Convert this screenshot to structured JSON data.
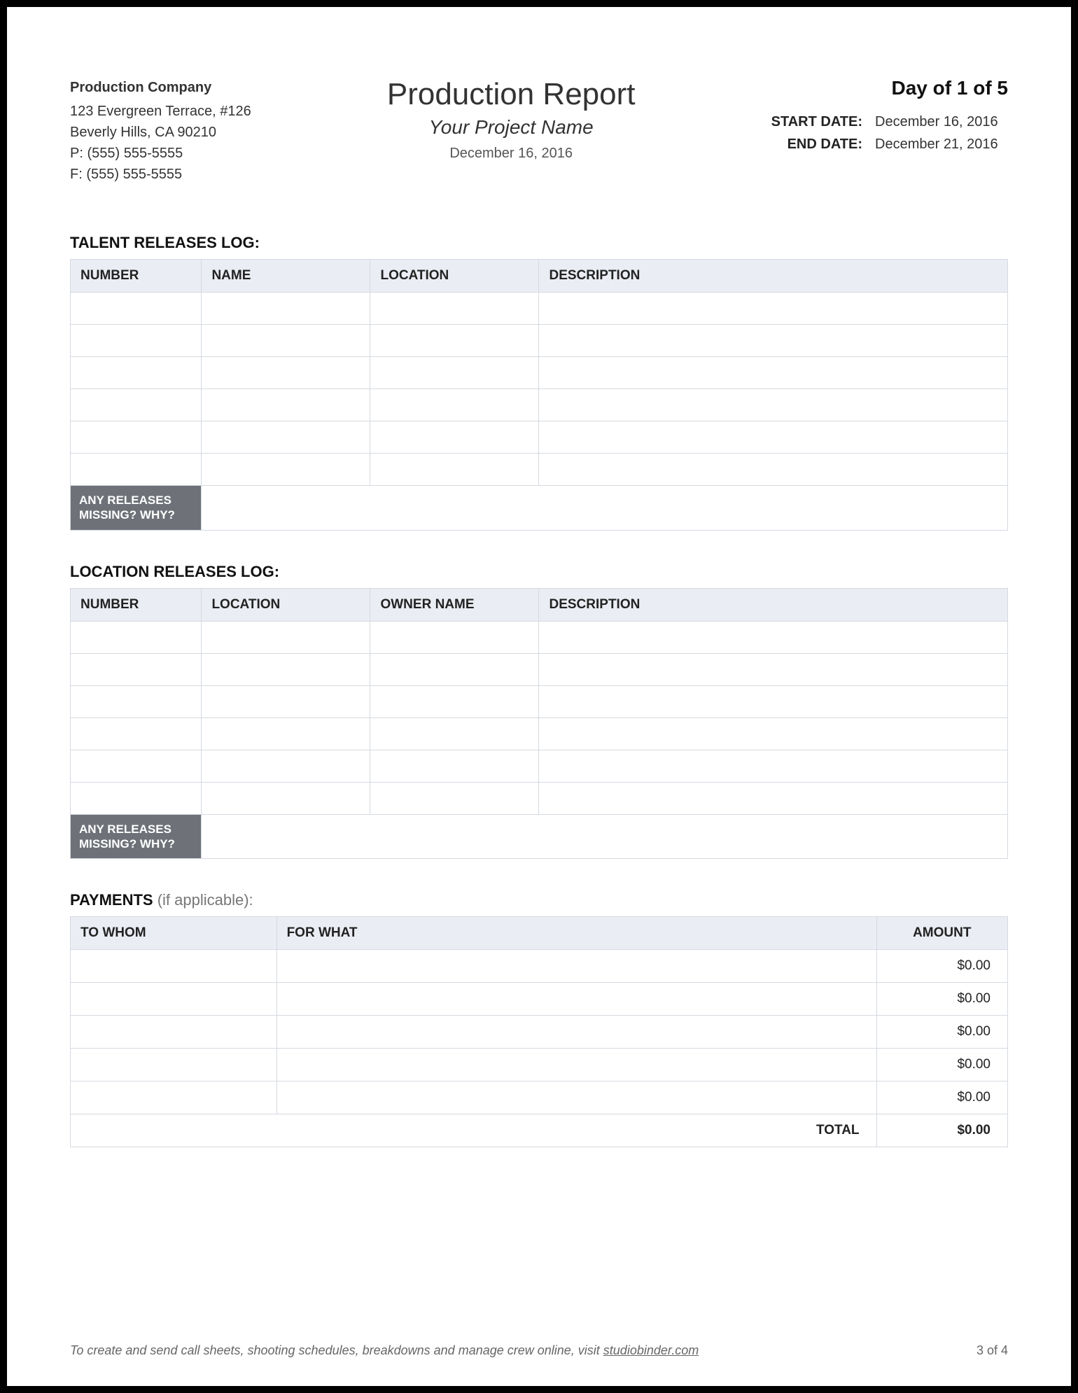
{
  "company": {
    "name": "Production Company",
    "address1": "123 Evergreen Terrace, #126",
    "address2": "Beverly Hills, CA 90210",
    "phone": "P: (555) 555-5555",
    "fax": "F: (555) 555-5555"
  },
  "title": {
    "main": "Production Report",
    "project": "Your Project Name",
    "date": "December 16, 2016"
  },
  "meta": {
    "day_of": "Day of 1 of 5",
    "start_label": "START DATE:",
    "start_value": "December 16, 2016",
    "end_label": "END DATE:",
    "end_value": "December 21, 2016"
  },
  "talent_releases": {
    "heading": "TALENT RELEASES LOG:",
    "columns": [
      "NUMBER",
      "NAME",
      "LOCATION",
      "DESCRIPTION"
    ],
    "rows": [
      [
        "",
        "",
        "",
        ""
      ],
      [
        "",
        "",
        "",
        ""
      ],
      [
        "",
        "",
        "",
        ""
      ],
      [
        "",
        "",
        "",
        ""
      ],
      [
        "",
        "",
        "",
        ""
      ],
      [
        "",
        "",
        "",
        ""
      ]
    ],
    "footer_label": "ANY RELEASES MISSING? WHY?",
    "footer_value": ""
  },
  "location_releases": {
    "heading": "LOCATION RELEASES LOG:",
    "columns": [
      "NUMBER",
      "LOCATION",
      "OWNER NAME",
      "DESCRIPTION"
    ],
    "rows": [
      [
        "",
        "",
        "",
        ""
      ],
      [
        "",
        "",
        "",
        ""
      ],
      [
        "",
        "",
        "",
        ""
      ],
      [
        "",
        "",
        "",
        ""
      ],
      [
        "",
        "",
        "",
        ""
      ],
      [
        "",
        "",
        "",
        ""
      ]
    ],
    "footer_label": "ANY RELEASES MISSING? WHY?",
    "footer_value": ""
  },
  "payments": {
    "heading_bold": "PAYMENTS",
    "heading_muted": "  (if applicable):",
    "columns": [
      "TO WHOM",
      "FOR WHAT",
      "AMOUNT"
    ],
    "rows": [
      {
        "to": "",
        "for": "",
        "amount": "$0.00"
      },
      {
        "to": "",
        "for": "",
        "amount": "$0.00"
      },
      {
        "to": "",
        "for": "",
        "amount": "$0.00"
      },
      {
        "to": "",
        "for": "",
        "amount": "$0.00"
      },
      {
        "to": "",
        "for": "",
        "amount": "$0.00"
      }
    ],
    "total_label": "TOTAL",
    "total_value": "$0.00"
  },
  "footer": {
    "text_prefix": "To create and send call sheets, shooting schedules, breakdowns and manage crew online, visit ",
    "link_text": "studiobinder.com",
    "page_num": "3 of 4"
  }
}
